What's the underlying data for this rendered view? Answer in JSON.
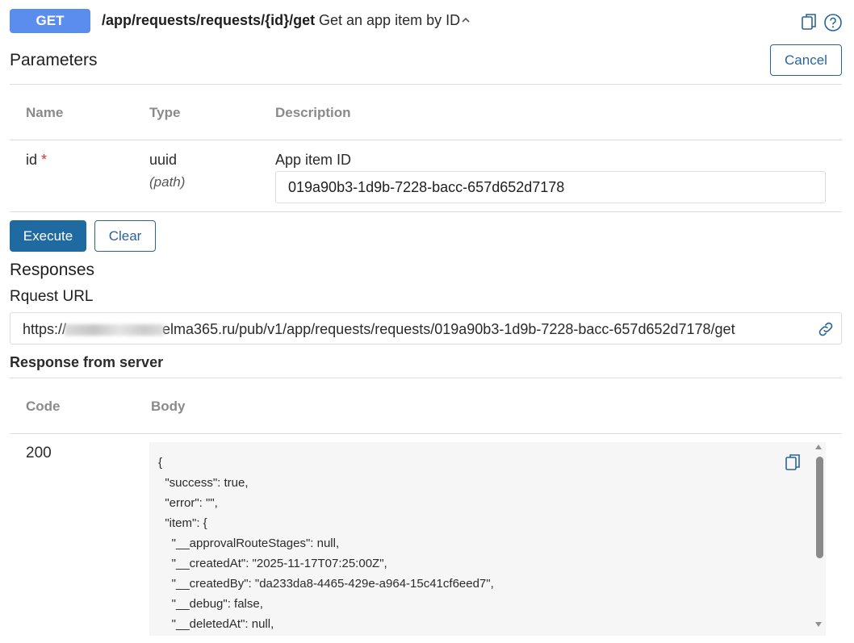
{
  "endpoint": {
    "method": "GET",
    "path": "/app/requests/requests/{id}/get",
    "summary": "Get an app item by ID",
    "icons": {
      "collapse": "chevron-up-icon",
      "copy": "copy-icon",
      "help": "help-icon"
    }
  },
  "parameters": {
    "title": "Parameters",
    "cancel_label": "Cancel",
    "headers": {
      "name": "Name",
      "type": "Type",
      "description": "Description"
    },
    "rows": [
      {
        "name": "id",
        "required_mark": "*",
        "type": "uuid",
        "in": "(path)",
        "description": "App item ID",
        "value": "019a90b3-1d9b-7228-bacc-657d652d7178"
      }
    ]
  },
  "actions": {
    "execute_label": "Execute",
    "clear_label": "Clear"
  },
  "responses": {
    "title": "Responses",
    "request_url_title": "Rquest URL",
    "request_url_prefix": "https://",
    "request_url_suffix": "elma365.ru/pub/v1/app/requests/requests/019a90b3-1d9b-7228-bacc-657d652d7178/get",
    "server_title": "Response from server",
    "headers": {
      "code": "Code",
      "body": "Body"
    },
    "code": "200",
    "body_lines": [
      "{",
      "  \"success\": true,",
      "  \"error\": \"\",",
      "  \"item\": {",
      "    \"__approvalRouteStages\": null,",
      "    \"__createdAt\": \"2025-11-17T07:25:00Z\",",
      "    \"__createdBy\": \"da233da8-4465-429e-a964-15c41cf6eed7\",",
      "    \"__debug\": false,",
      "    \"__deletedAt\": null,"
    ]
  },
  "colors": {
    "method_badge": "#5b8def",
    "primary_button": "#1f6aa0",
    "outline_button": "#2a6496",
    "required": "#d9302a",
    "code_bg": "#f6f6f6"
  }
}
